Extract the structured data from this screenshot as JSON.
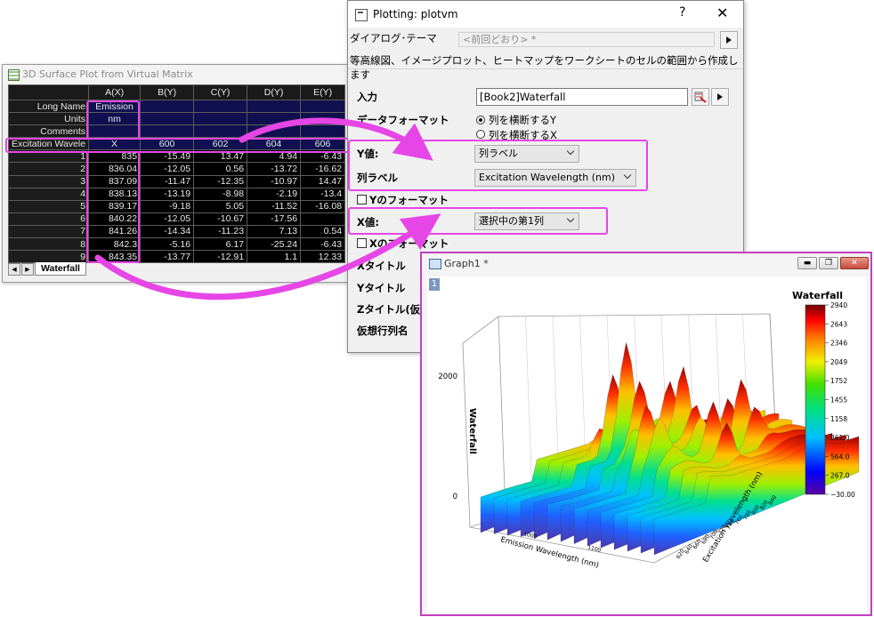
{
  "worksheet": {
    "title": "3D Surface Plot from Virtual Matrix",
    "columns": [
      "A(X)",
      "B(Y)",
      "C(Y)",
      "D(Y)",
      "E(Y)"
    ],
    "meta_rows": [
      {
        "label": "Long Name",
        "values": [
          "Emission",
          "",
          "",
          "",
          ""
        ]
      },
      {
        "label": "Units",
        "values": [
          "nm",
          "",
          "",
          "",
          ""
        ]
      },
      {
        "label": "Comments",
        "values": [
          "",
          "",
          "",
          "",
          ""
        ]
      },
      {
        "label": "Excitation Wavele",
        "values": [
          "X",
          "600",
          "602",
          "604",
          "606"
        ]
      }
    ],
    "data_rows": [
      {
        "n": "1",
        "values": [
          "835",
          "-15.49",
          "13.47",
          "4.94",
          "-6.43"
        ]
      },
      {
        "n": "2",
        "values": [
          "836.04",
          "-12.05",
          "0.56",
          "-13.72",
          "-16.62"
        ]
      },
      {
        "n": "3",
        "values": [
          "837.09",
          "-11.47",
          "-12.35",
          "-10.97",
          "14.47"
        ]
      },
      {
        "n": "4",
        "values": [
          "838.13",
          "-13.19",
          "-8.98",
          "-2.19",
          "-13.4"
        ]
      },
      {
        "n": "5",
        "values": [
          "839.17",
          "-9.18",
          "5.05",
          "-11.52",
          "-16.08"
        ]
      },
      {
        "n": "6",
        "values": [
          "840.22",
          "-12.05",
          "-10.67",
          "-17.56",
          ""
        ]
      },
      {
        "n": "7",
        "values": [
          "841.26",
          "-14.34",
          "-11.23",
          "7.13",
          "0.54"
        ]
      },
      {
        "n": "8",
        "values": [
          "842.3",
          "-5.16",
          "6.17",
          "-25.24",
          "-6.43"
        ]
      },
      {
        "n": "9",
        "values": [
          "843.35",
          "-13.77",
          "-12.91",
          "1.1",
          "12.33"
        ]
      }
    ],
    "sheet_tab": "Waterfall"
  },
  "dialog": {
    "title": "Plotting: plotvm",
    "help": "?",
    "close": "✕",
    "theme_label": "ダイアログ･テーマ",
    "theme_value": "<前回どおり> *",
    "description": "等高線図、イメージプロット、ヒートマップをワークシートのセルの範囲から作成します",
    "input_label": "入力",
    "input_value": "[Book2]Waterfall",
    "data_format_label": "データフォーマット",
    "radio1": "列を横断するY",
    "radio2": "列を横断するX",
    "yvalue_label": "Y値:",
    "yvalue_value": "列ラベル",
    "collabel_label": "列ラベル",
    "collabel_value": "Excitation Wavelength (nm)",
    "yformat_label": "Yのフォーマット",
    "xvalue_label": "X値:",
    "xvalue_value": "選択中の第1列",
    "xformat_label": "Xのフォーマット",
    "xtitle_label": "Xタイトル",
    "ytitle_label": "Yタイトル",
    "ztitle_label": "Zタイトル(仮想",
    "vrow_label": "仮想行列名"
  },
  "graph": {
    "title": "Graph1 *",
    "layer": "1",
    "legend_title": "Waterfall",
    "legend_ticks": [
      "2940",
      "2643",
      "2346",
      "2049",
      "1752",
      "1455",
      "1158",
      "861.0",
      "564.0",
      "267.0",
      "−30.00"
    ],
    "z_axis_label": "Waterfall",
    "z_ticks": [
      "2000",
      "0"
    ],
    "x_axis_label": "Emission Wavelength (nm)",
    "x_ticks": [
      "1000",
      "1100"
    ],
    "y_axis_label": "Excitation Wavelength (nm)",
    "y_ticks": [
      "620",
      "640",
      "660",
      "680",
      "700",
      "720",
      "740",
      "760",
      "780",
      "800",
      "820",
      "840"
    ]
  },
  "colors": {
    "highlight": "#e646e6",
    "grid_header": "#1a1a1a",
    "grid_meta": "#101050"
  }
}
